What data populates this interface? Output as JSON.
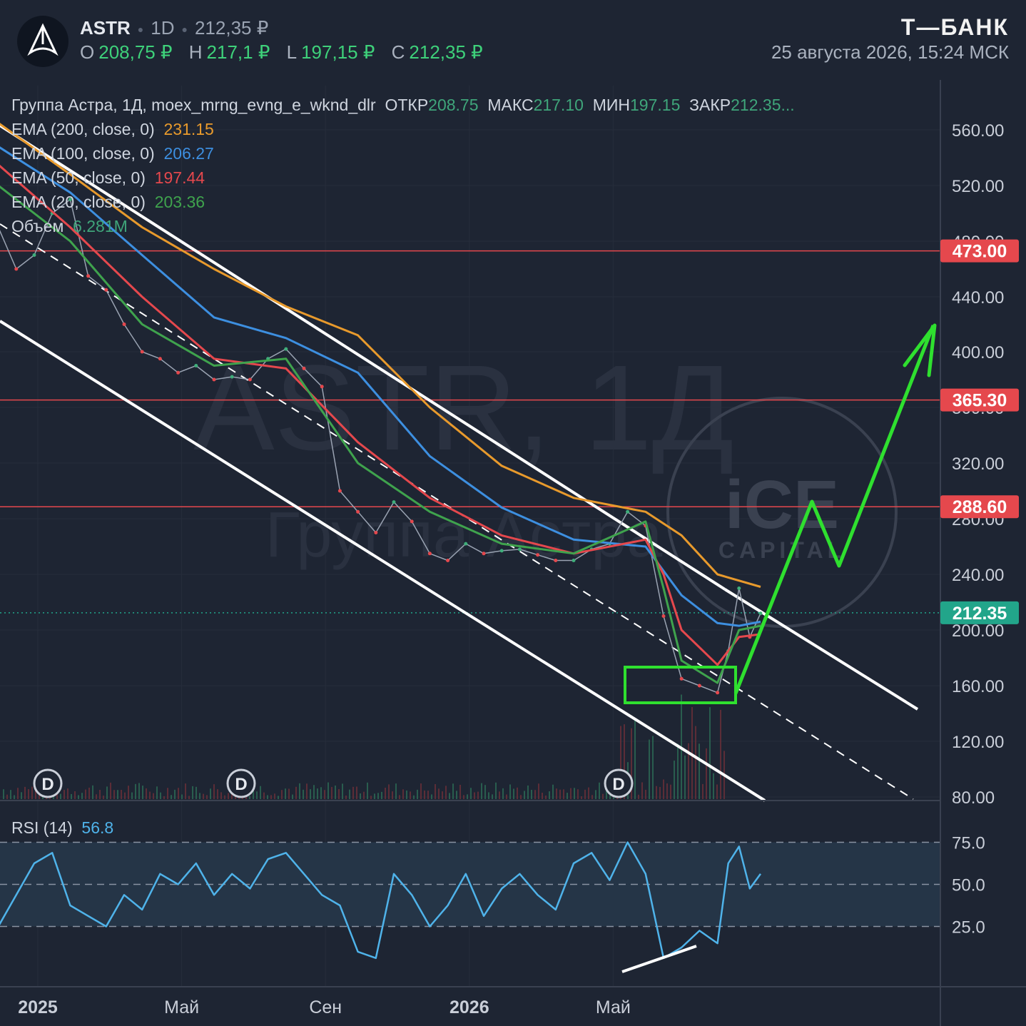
{
  "header": {
    "ticker": "ASTR",
    "interval": "1D",
    "last_price": "212,35 ₽",
    "ohlc": [
      {
        "k": "O",
        "v": "208,75 ₽"
      },
      {
        "k": "H",
        "v": "217,1 ₽"
      },
      {
        "k": "L",
        "v": "197,15 ₽"
      },
      {
        "k": "C",
        "v": "212,35 ₽"
      }
    ],
    "brand": "T—БАНК",
    "timestamp": "25 августа 2026, 15:24 МСК"
  },
  "legend": {
    "series_title": "Группа Астра, 1Д, moex_mrng_evng_e_wknd_dlr",
    "open_k": "ОТКР",
    "open_v": "208.75",
    "high_k": "МАКС",
    "high_v": "217.10",
    "low_k": "МИН",
    "low_v": "197.15",
    "close_k": "ЗАКР",
    "close_v": "212.35...",
    "ema200_label": "EMA (200, close, 0)",
    "ema200_value": "231.15",
    "ema200_color": "#e89a2c",
    "ema100_label": "EMA (100, close, 0)",
    "ema100_value": "206.27",
    "ema100_color": "#3d8fe0",
    "ema50_label": "EMA (50, close, 0)",
    "ema50_value": "197.44",
    "ema50_color": "#e5484d",
    "ema20_label": "EMA (20, close, 0)",
    "ema20_value": "203.36",
    "ema20_color": "#3fa34d",
    "volume_label": "Объем",
    "volume_value": "6.281M"
  },
  "watermark": {
    "line1": "ASTR, 1Д",
    "line2": "Группа Астра",
    "logo_top": "iCE",
    "logo_bottom": "CAPITAL"
  },
  "rsi": {
    "label": "RSI (14)",
    "value": "56.8",
    "color": "#4fb3ea"
  },
  "chart_data": [
    {
      "type": "line",
      "title": "ASTR, 1D",
      "ylim": [
        80,
        580
      ],
      "y_ticks": [
        "560.00",
        "520.00",
        "480.00",
        "440.00",
        "400.00",
        "360.00",
        "320.00",
        "280.00",
        "240.00",
        "200.00",
        "160.00",
        "120.00",
        "80.00"
      ],
      "x_ticks": [
        {
          "label": "2025",
          "x": 0.0
        },
        {
          "label": "Май",
          "x": 4.0
        },
        {
          "label": "Сен",
          "x": 8.0
        },
        {
          "label": "2026",
          "x": 12.0
        },
        {
          "label": "Май",
          "x": 16.0
        }
      ],
      "xlim": [
        -1.1,
        26.0
      ],
      "price_levels": [
        {
          "label": "473.00",
          "value": 473.0,
          "color": "#e5484d"
        },
        {
          "label": "365.30",
          "value": 365.3,
          "color": "#e5484d"
        },
        {
          "label": "288.60",
          "value": 288.6,
          "color": "#e5484d"
        },
        {
          "label": "212.35",
          "value": 212.35,
          "color": "#22a58a"
        }
      ],
      "series": [
        {
          "name": "Close",
          "color": "#9aa3b2",
          "x": [
            -1.1,
            -0.6,
            -0.1,
            0.4,
            0.9,
            1.4,
            1.9,
            2.4,
            2.9,
            3.4,
            3.9,
            4.4,
            4.9,
            5.4,
            5.9,
            6.4,
            6.9,
            7.4,
            7.9,
            8.4,
            8.9,
            9.4,
            9.9,
            10.4,
            10.9,
            11.4,
            11.9,
            12.4,
            12.9,
            13.4,
            13.9,
            14.4,
            14.9,
            15.4,
            15.9,
            16.4,
            16.9,
            17.4,
            17.9,
            18.4,
            18.9,
            19.2,
            19.5,
            19.8,
            20.1
          ],
          "values": [
            490,
            460,
            470,
            500,
            510,
            455,
            445,
            420,
            400,
            395,
            385,
            390,
            380,
            382,
            380,
            395,
            402,
            388,
            375,
            300,
            285,
            270,
            292,
            278,
            255,
            250,
            262,
            255,
            257,
            258,
            254,
            250,
            250,
            258,
            262,
            285,
            275,
            210,
            165,
            160,
            155,
            185,
            230,
            195,
            212
          ]
        },
        {
          "name": "EMA 200",
          "color": "#e89a2c",
          "x": [
            -1.1,
            0.9,
            2.9,
            4.9,
            6.9,
            8.9,
            10.9,
            12.9,
            14.9,
            16.9,
            17.9,
            18.9,
            20.1
          ],
          "values": [
            565,
            528,
            490,
            460,
            433,
            412,
            360,
            318,
            295,
            285,
            268,
            240,
            231
          ]
        },
        {
          "name": "EMA 100",
          "color": "#3d8fe0",
          "x": [
            -1.1,
            0.9,
            2.9,
            4.9,
            6.9,
            8.9,
            10.9,
            12.9,
            14.9,
            16.9,
            17.9,
            18.9,
            19.5,
            20.1
          ],
          "values": [
            548,
            515,
            470,
            425,
            410,
            385,
            325,
            288,
            265,
            260,
            225,
            205,
            203,
            206
          ]
        },
        {
          "name": "EMA 50",
          "color": "#e5484d",
          "x": [
            -1.1,
            0.9,
            2.9,
            4.9,
            6.9,
            8.9,
            10.9,
            12.9,
            14.9,
            16.9,
            17.4,
            17.9,
            18.9,
            19.5,
            20.1
          ],
          "values": [
            535,
            490,
            440,
            395,
            388,
            335,
            295,
            268,
            255,
            265,
            240,
            200,
            175,
            195,
            197
          ]
        },
        {
          "name": "EMA 20",
          "color": "#3fa34d",
          "x": [
            -1.1,
            0.9,
            2.9,
            4.9,
            6.9,
            8.9,
            10.9,
            12.9,
            14.9,
            16.9,
            17.4,
            17.9,
            18.9,
            19.5,
            20.1
          ],
          "values": [
            520,
            480,
            420,
            390,
            395,
            320,
            285,
            262,
            255,
            278,
            230,
            178,
            162,
            200,
            203
          ]
        }
      ]
    },
    {
      "type": "line",
      "title": "RSI (14)",
      "ylim": [
        0,
        90
      ],
      "y_ticks": [
        "75.0",
        "50.0",
        "25.0"
      ],
      "bands": [
        70,
        50,
        30
      ],
      "series": [
        {
          "name": "RSI (14)",
          "color": "#4fb3ea",
          "x": [
            -1.1,
            -0.6,
            -0.1,
            0.4,
            0.9,
            1.4,
            1.9,
            2.4,
            2.9,
            3.4,
            3.9,
            4.4,
            4.9,
            5.4,
            5.9,
            6.4,
            6.9,
            7.4,
            7.9,
            8.4,
            8.9,
            9.4,
            9.9,
            10.4,
            10.9,
            11.4,
            11.9,
            12.4,
            12.9,
            13.4,
            13.9,
            14.4,
            14.9,
            15.4,
            15.9,
            16.4,
            16.9,
            17.4,
            17.9,
            18.4,
            18.9,
            19.2,
            19.5,
            19.8,
            20.1
          ],
          "values": [
            30,
            45,
            60,
            65,
            40,
            35,
            30,
            45,
            38,
            55,
            50,
            60,
            45,
            55,
            48,
            62,
            65,
            55,
            45,
            40,
            18,
            15,
            55,
            45,
            30,
            40,
            55,
            35,
            48,
            55,
            45,
            38,
            60,
            65,
            52,
            70,
            55,
            15,
            20,
            28,
            22,
            60,
            68,
            48,
            55
          ]
        }
      ]
    }
  ]
}
